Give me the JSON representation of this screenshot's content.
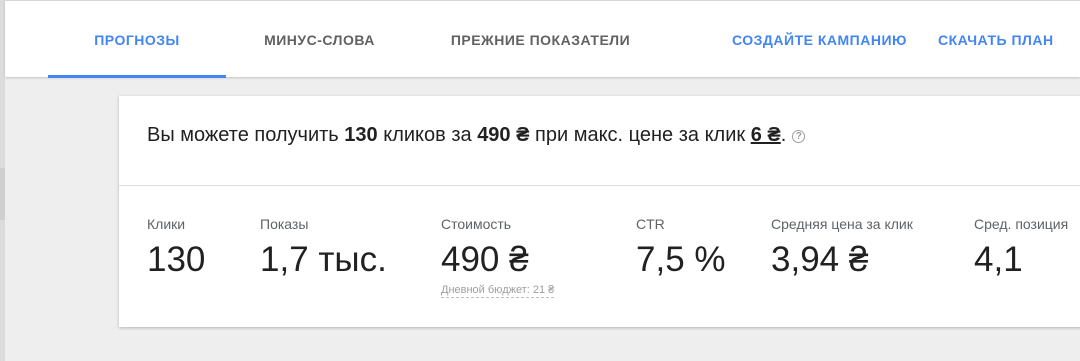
{
  "tabs": [
    {
      "label": "ПРОГНОЗЫ",
      "active": true
    },
    {
      "label": "МИНУС-СЛОВА",
      "active": false
    },
    {
      "label": "ПРЕЖНИЕ ПОКАЗАТЕЛИ",
      "active": false
    }
  ],
  "actions": {
    "create_campaign": "СОЗДАЙТЕ КАМПАНИЮ",
    "download_plan": "СКАЧАТЬ ПЛАН"
  },
  "summary": {
    "prefix": "Вы можете получить ",
    "clicks": "130",
    "clicks_text": " кликов за ",
    "cost": "490 ₴",
    "mid_text": " при макс. цене за клик ",
    "max_cpc": "6 ₴",
    "suffix": "."
  },
  "metrics": [
    {
      "label": "Клики",
      "value": "130"
    },
    {
      "label": "Показы",
      "value": "1,7 тыс."
    },
    {
      "label": "Стоимость",
      "value": "490 ₴",
      "sub": "Дневной бюджет: 21 ₴"
    },
    {
      "label": "CTR",
      "value": "7,5 %"
    },
    {
      "label": "Средняя цена за клик",
      "value": "3,94 ₴"
    },
    {
      "label": "Сред. позиция",
      "value": "4,1"
    }
  ],
  "colors": {
    "accent": "#4285f4",
    "tab_inactive": "#616161",
    "background": "#eeeeee"
  },
  "icons": {
    "help": "question-circle-icon"
  }
}
